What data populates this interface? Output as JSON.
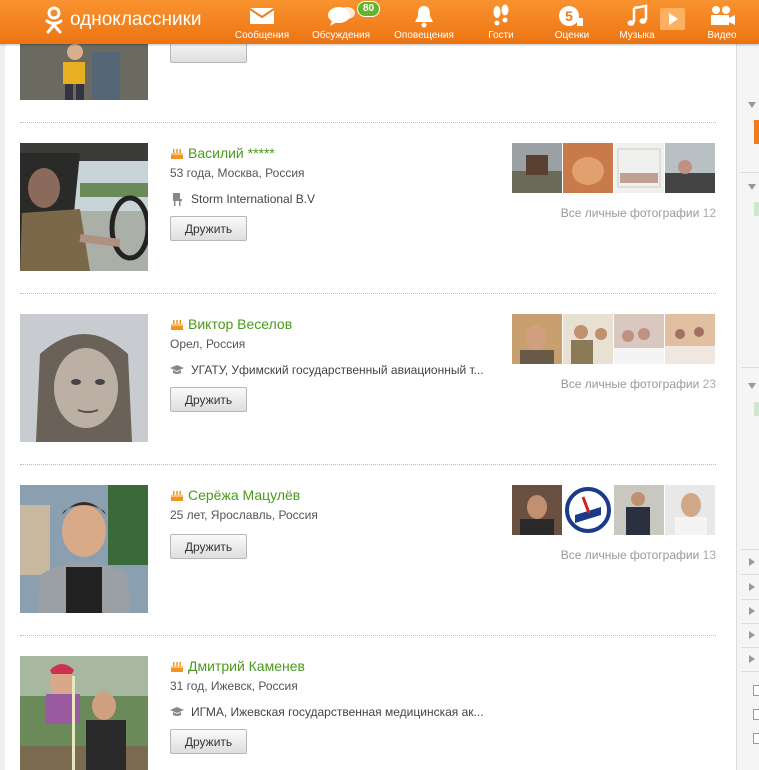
{
  "app": {
    "name": "одноклассники"
  },
  "nav": [
    {
      "label": "Сообщения",
      "icon": "envelope-icon"
    },
    {
      "label": "Обсуждения",
      "icon": "discussion-icon",
      "badge": "80"
    },
    {
      "label": "Оповещения",
      "icon": "bell-icon"
    },
    {
      "label": "Гости",
      "icon": "footprints-icon"
    },
    {
      "label": "Оценки",
      "icon": "rating-5-icon",
      "rating": "5"
    },
    {
      "label": "Музыка",
      "icon": "music-icon"
    },
    {
      "label": "Видео",
      "icon": "video-camera-icon"
    }
  ],
  "colors": {
    "brand": "#f07c1c",
    "name_link": "#4a9a1c",
    "badge": "#66b32e"
  },
  "people": [
    {
      "name": "Василий *****",
      "meta": "53 года, Москва, Россия",
      "work_icon": "chair-icon",
      "work": "Storm International B.V",
      "button": "Дружить",
      "all_photos_label": "Все личные фотографии",
      "photo_count": "12"
    },
    {
      "name": "Виктор Веселов",
      "meta": "Орел, Россия",
      "work_icon": "graduation-cap-icon",
      "work": "УГАТУ, Уфимский государственный авиационный т...",
      "button": "Дружить",
      "all_photos_label": "Все личные фотографии",
      "photo_count": "23"
    },
    {
      "name": "Серёжа Мацулёв",
      "meta": "25 лет, Ярославль, Россия",
      "button": "Дружить",
      "all_photos_label": "Все личные фотографии",
      "photo_count": "13"
    },
    {
      "name": "Дмитрий Каменев",
      "meta": "31 год, Ижевск, Россия",
      "work_icon": "graduation-cap-icon",
      "work": "ИГМА, Ижевская государственная медицинская ак...",
      "button": "Дружить"
    }
  ],
  "partial_row": {
    "button": ""
  }
}
